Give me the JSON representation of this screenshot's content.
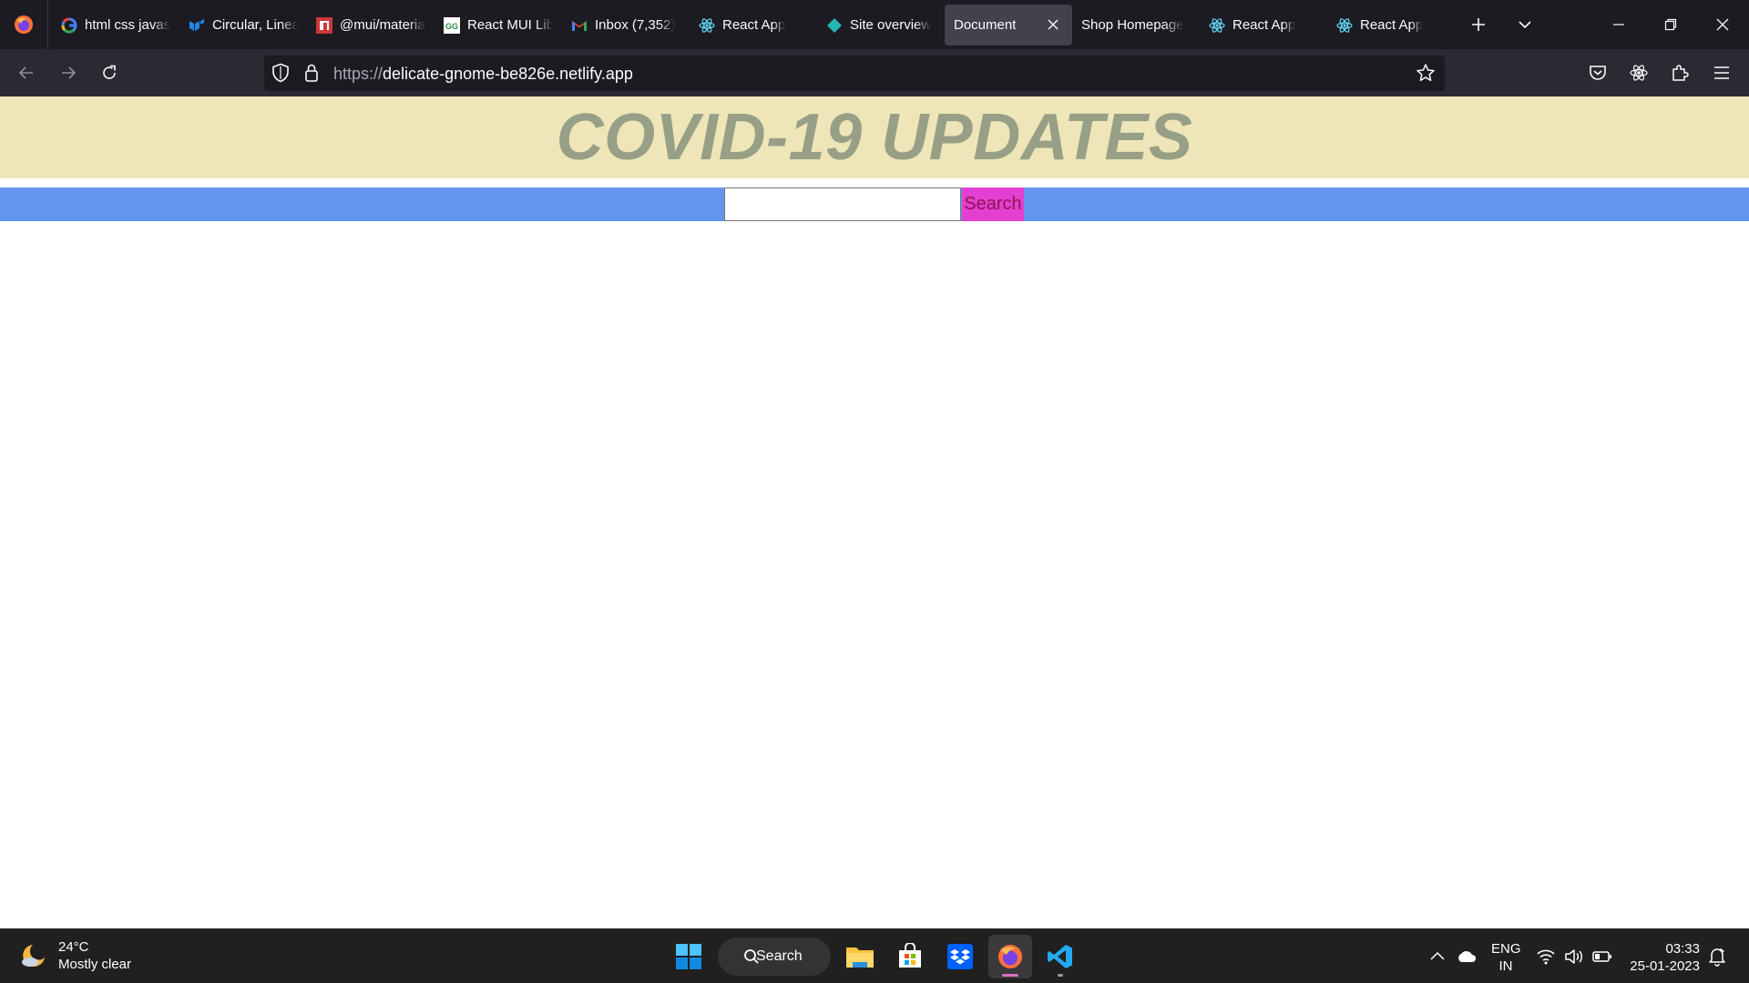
{
  "browser": {
    "tabs": [
      {
        "title": "html css javascript",
        "icon": "google-icon",
        "color": "#4285f4"
      },
      {
        "title": "Circular, Linear",
        "icon": "mui-icon",
        "color": "#1e88e5"
      },
      {
        "title": "@mui/material",
        "icon": "npm-icon",
        "color": "#cb3837"
      },
      {
        "title": "React MUI Library",
        "icon": "gfg-icon",
        "color": "#2f8d46"
      },
      {
        "title": "Inbox (7,352)",
        "icon": "gmail-icon",
        "color": "#ea4335"
      },
      {
        "title": "React App",
        "icon": "react-icon",
        "color": "#61dafb"
      },
      {
        "title": "Site overview",
        "icon": "netlify-icon",
        "color": "#26b5b3"
      },
      {
        "title": "Document",
        "icon": "none",
        "active": true
      },
      {
        "title": "Shop Homepage",
        "icon": "none"
      },
      {
        "title": "React App",
        "icon": "react-icon",
        "color": "#61dafb"
      },
      {
        "title": "React App",
        "icon": "react-icon",
        "color": "#61dafb"
      }
    ],
    "url": {
      "scheme": "https://",
      "host": "delicate-gnome-be826e.netlify.app"
    }
  },
  "page": {
    "heading": "COVID-19 UPDATES",
    "search": {
      "value": "",
      "placeholder": "",
      "button_label": "Search"
    },
    "colors": {
      "banner_bg": "#eee6b8",
      "heading": "#97a086",
      "search_bar_bg": "#6495ed",
      "search_button_bg": "#e33fd0"
    }
  },
  "taskbar": {
    "weather": {
      "temp": "24°C",
      "condition": "Mostly clear"
    },
    "search_label": "Search",
    "language": {
      "line1": "ENG",
      "line2": "IN"
    },
    "clock": {
      "time": "03:33",
      "date": "25-01-2023"
    }
  }
}
